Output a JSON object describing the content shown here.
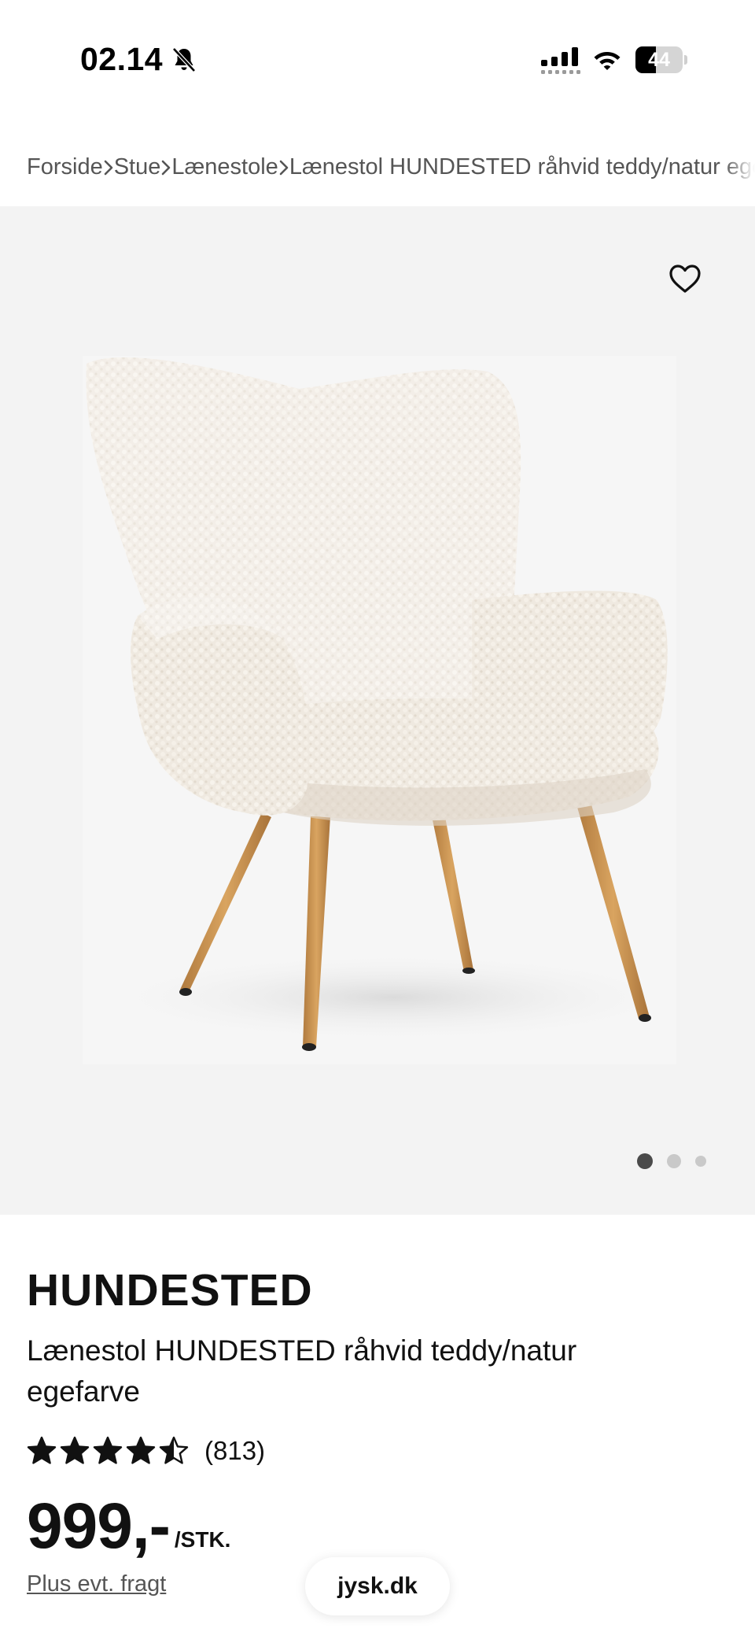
{
  "status_bar": {
    "time": "02.14",
    "battery_level": "44",
    "battery_fraction": 0.44
  },
  "breadcrumb": {
    "items": [
      "Forside",
      "Stue",
      "Lænestole",
      "Lænestol HUNDESTED råhvid teddy/natur egefarve"
    ]
  },
  "gallery": {
    "image_count": 3,
    "active_index": 0,
    "favorite_icon": "heart-icon"
  },
  "product": {
    "brand": "HUNDESTED",
    "description": "Lænestol HUNDESTED råhvid teddy/natur egefarve",
    "rating": 4.5,
    "rating_max": 5,
    "review_count": "(813)",
    "price": "999,-",
    "price_unit": "/STK.",
    "shipping_note": "Plus evt. fragt"
  },
  "browser": {
    "url": "jysk.dk"
  },
  "colors": {
    "gallery_bg": "#f3f3f3",
    "text": "#111111",
    "muted": "#555555",
    "dot_active": "#4a4a4a",
    "dot_inactive": "#c9c9c9"
  }
}
